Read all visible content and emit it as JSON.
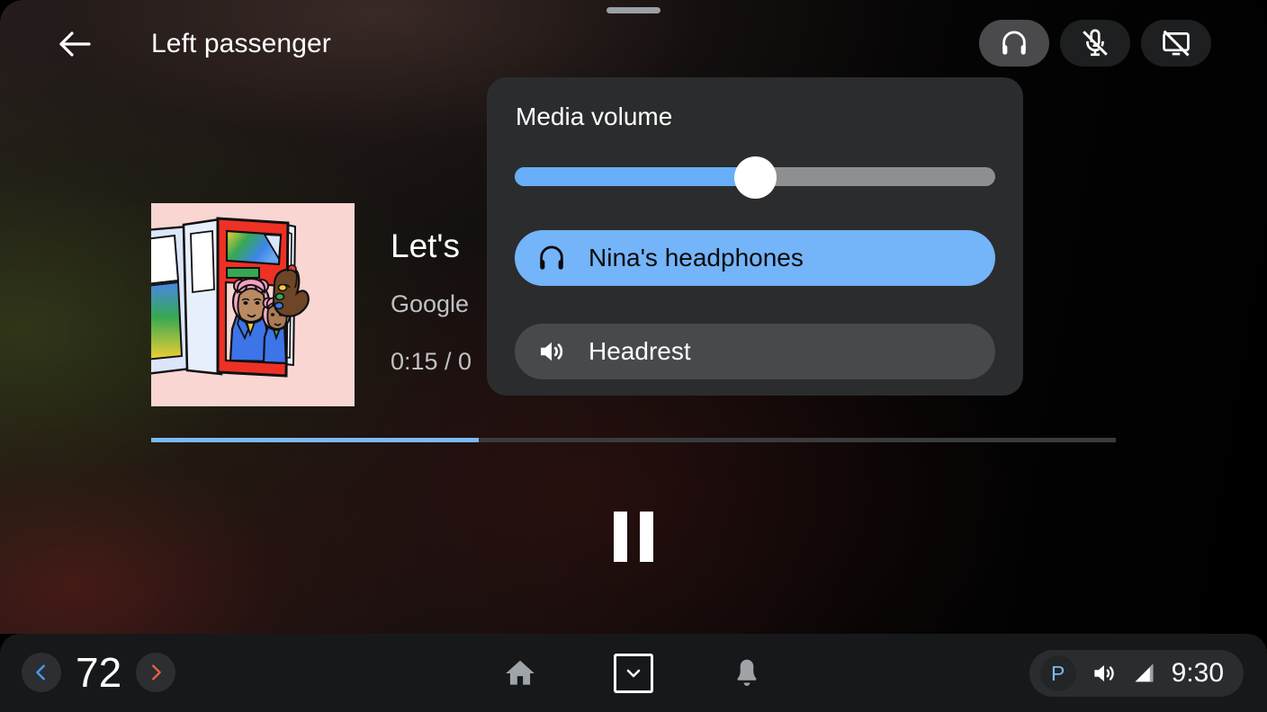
{
  "app_bar": {
    "back_icon": "arrow-left-icon",
    "title": "Left passenger",
    "actions": [
      {
        "icon": "headphones-icon",
        "name": "headphones-toggle",
        "active": true
      },
      {
        "icon": "mic-off-icon",
        "name": "mic-off-toggle",
        "active": false
      },
      {
        "icon": "screen-off-icon",
        "name": "screen-off-toggle",
        "active": false
      }
    ]
  },
  "drag_handle": "drag-handle",
  "media": {
    "album_art_alt": "two women with pink hair holding a red magazine",
    "title": "Let's",
    "artist": "Google",
    "time": "0:15 / 0",
    "progress_percent": 34,
    "transport": {
      "state_icon": "pause-icon",
      "label": "Pause"
    }
  },
  "volume_popup": {
    "title": "Media volume",
    "slider": {
      "name": "media-volume-slider",
      "value_percent": 50,
      "fill_color": "#68aef8",
      "track_color": "#8d8f91"
    },
    "devices": [
      {
        "label": "Nina's headphones",
        "icon": "headphones-icon",
        "selected": true,
        "color": "#74b4f9"
      },
      {
        "label": "Headrest",
        "icon": "speaker-volume-icon",
        "selected": false,
        "color": "#47494b"
      }
    ]
  },
  "system_bar": {
    "temperature": {
      "decrease_icon": "chevron-left-icon",
      "decrease_color": "#4a9bf0",
      "value": "72",
      "increase_icon": "chevron-right-icon",
      "increase_color": "#e8604a"
    },
    "nav": [
      {
        "icon": "home-icon",
        "name": "nav-home"
      },
      {
        "icon": "chevron-down-boxed-icon",
        "name": "nav-app-switcher"
      },
      {
        "icon": "bell-icon",
        "name": "nav-notifications"
      }
    ],
    "status": {
      "gear_label": "P",
      "gear_color": "#7cb9f7",
      "volume_icon": "speaker-volume-icon",
      "signal_icon": "signal-bars-icon",
      "clock": "9:30"
    }
  }
}
